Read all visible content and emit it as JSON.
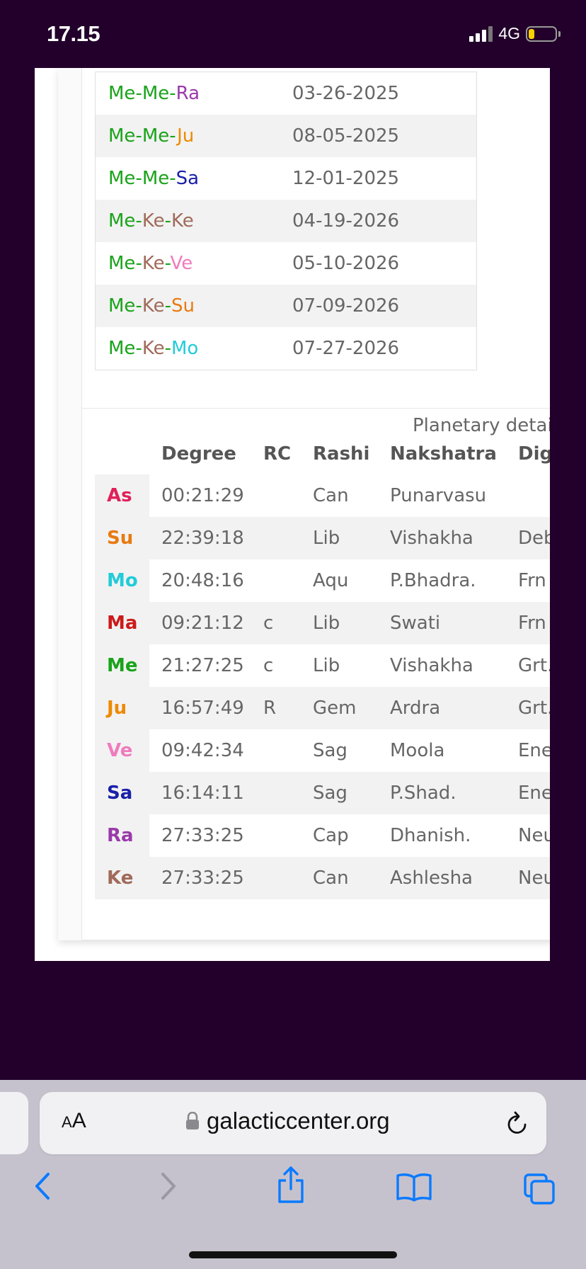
{
  "status_bar": {
    "time": "17.15",
    "network": "4G"
  },
  "dasha_rows": [
    {
      "p1": "Me",
      "s1": "-",
      "p2": "Me",
      "s2": "-",
      "p3": "Ra",
      "c1": "#1aa31a",
      "c2": "#1aa31a",
      "c3": "#9a3aaa",
      "date": "03-26-2025"
    },
    {
      "p1": "Me",
      "s1": "-",
      "p2": "Me",
      "s2": "-",
      "p3": "Ju",
      "c1": "#1aa31a",
      "c2": "#1aa31a",
      "c3": "#ee8a00",
      "date": "08-05-2025"
    },
    {
      "p1": "Me",
      "s1": "-",
      "p2": "Me",
      "s2": "-",
      "p3": "Sa",
      "c1": "#1aa31a",
      "c2": "#1aa31a",
      "c3": "#1a20a8",
      "date": "12-01-2025"
    },
    {
      "p1": "Me",
      "s1": "-",
      "p2": "Ke",
      "s2": "-",
      "p3": "Ke",
      "c1": "#1aa31a",
      "c2": "#a06a5a",
      "c3": "#a06a5a",
      "date": "04-19-2026"
    },
    {
      "p1": "Me",
      "s1": "-",
      "p2": "Ke",
      "s2": "-",
      "p3": "Ve",
      "c1": "#1aa31a",
      "c2": "#a06a5a",
      "c3": "#f07bbd",
      "date": "05-10-2026"
    },
    {
      "p1": "Me",
      "s1": "-",
      "p2": "Ke",
      "s2": "-",
      "p3": "Su",
      "c1": "#1aa31a",
      "c2": "#a06a5a",
      "c3": "#e87a10",
      "date": "07-09-2026"
    },
    {
      "p1": "Me",
      "s1": "-",
      "p2": "Ke",
      "s2": "-",
      "p3": "Mo",
      "c1": "#1aa31a",
      "c2": "#a06a5a",
      "c3": "#22ccd8",
      "date": "07-27-2026"
    }
  ],
  "planetary": {
    "caption": "Planetary detai",
    "headers": {
      "degree": "Degree",
      "rc": "RC",
      "rashi": "Rashi",
      "nakshatra": "Nakshatra",
      "dignity": "Dig"
    },
    "rows": [
      {
        "planet": "As",
        "color": "#e0205a",
        "degree": "00:21:29",
        "rc": "",
        "rashi": "Can",
        "nakshatra": "Punarvasu",
        "dignity": ""
      },
      {
        "planet": "Su",
        "color": "#e87a10",
        "degree": "22:39:18",
        "rc": "",
        "rashi": "Lib",
        "nakshatra": "Vishakha",
        "dignity": "Deb"
      },
      {
        "planet": "Mo",
        "color": "#22ccd8",
        "degree": "20:48:16",
        "rc": "",
        "rashi": "Aqu",
        "nakshatra": "P.Bhadra.",
        "dignity": "Frn"
      },
      {
        "planet": "Ma",
        "color": "#cc1a1a",
        "degree": "09:21:12",
        "rc": "c",
        "rashi": "Lib",
        "nakshatra": "Swati",
        "dignity": "Frn"
      },
      {
        "planet": "Me",
        "color": "#1aa31a",
        "degree": "21:27:25",
        "rc": "c",
        "rashi": "Lib",
        "nakshatra": "Vishakha",
        "dignity": "Grt."
      },
      {
        "planet": "Ju",
        "color": "#ee8a00",
        "degree": "16:57:49",
        "rc": "R",
        "rashi": "Gem",
        "nakshatra": "Ardra",
        "dignity": "Grt."
      },
      {
        "planet": "Ve",
        "color": "#f07bbd",
        "degree": "09:42:34",
        "rc": "",
        "rashi": "Sag",
        "nakshatra": "Moola",
        "dignity": "Ene"
      },
      {
        "planet": "Sa",
        "color": "#1a20a8",
        "degree": "16:14:11",
        "rc": "",
        "rashi": "Sag",
        "nakshatra": "P.Shad.",
        "dignity": "Ene"
      },
      {
        "planet": "Ra",
        "color": "#9a3aaa",
        "degree": "27:33:25",
        "rc": "",
        "rashi": "Cap",
        "nakshatra": "Dhanish.",
        "dignity": "Neu"
      },
      {
        "planet": "Ke",
        "color": "#a06a5a",
        "degree": "27:33:25",
        "rc": "",
        "rashi": "Can",
        "nakshatra": "Ashlesha",
        "dignity": "Neu"
      }
    ]
  },
  "safari": {
    "text_size_big": "A",
    "text_size_small": "A",
    "url": "galacticcenter.org",
    "icons": {
      "back": "chevron-left-icon",
      "forward": "chevron-right-icon",
      "share": "share-icon",
      "bookmarks": "book-icon",
      "tabs": "tabs-icon",
      "lock": "lock-icon",
      "reload": "reload-icon"
    },
    "accent": "#0a7aff"
  }
}
